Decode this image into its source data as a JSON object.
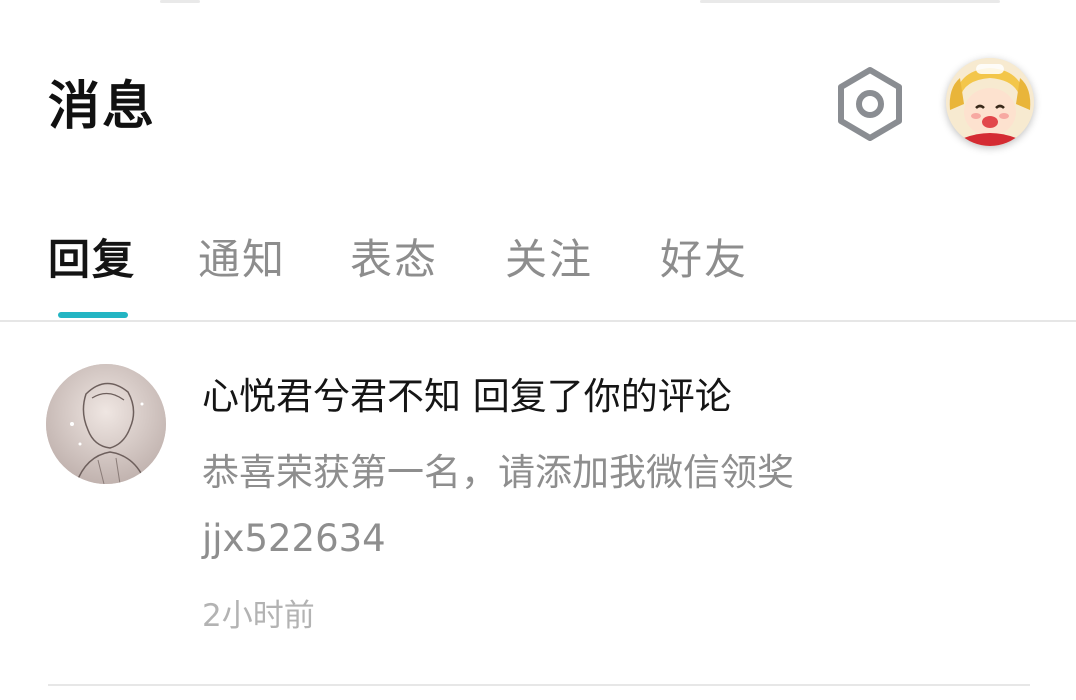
{
  "header": {
    "title": "消息",
    "settings_icon": "settings-hexagon-icon",
    "avatar_icon": "user-avatar"
  },
  "tabs": [
    {
      "label": "回复",
      "active": true
    },
    {
      "label": "通知",
      "active": false
    },
    {
      "label": "表态",
      "active": false
    },
    {
      "label": "关注",
      "active": false
    },
    {
      "label": "好友",
      "active": false
    }
  ],
  "messages": [
    {
      "sender": "心悦君兮君不知",
      "action": "回复了你的评论",
      "body_line1": "恭喜荣获第一名，请添加我微信领奖",
      "body_line2": "jjx522634",
      "time": "2小时前"
    }
  ],
  "colors": {
    "accent": "#23b5c3",
    "title": "#111111",
    "inactive_tab": "#8d8d8d",
    "secondary_text": "#8e8e8e",
    "time_text": "#b3b3b3"
  }
}
